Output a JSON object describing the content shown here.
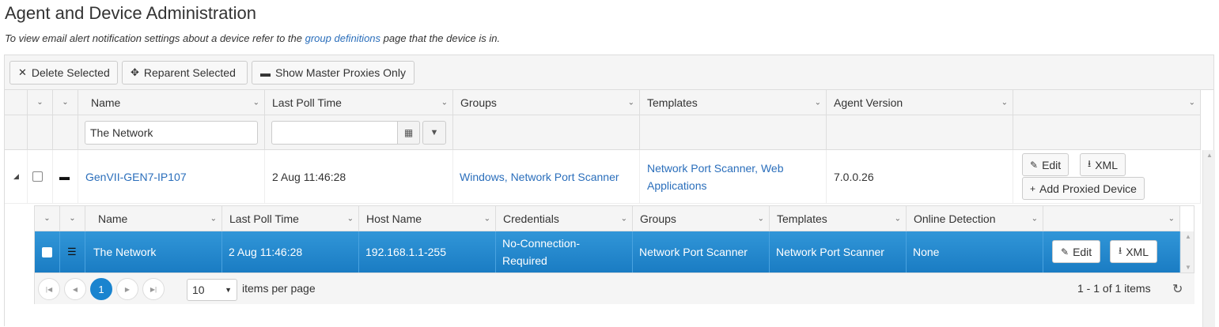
{
  "page": {
    "title": "Agent and Device Administration",
    "subtitle_prefix": "To view email alert notification settings about a device refer to the ",
    "subtitle_link": "group definitions",
    "subtitle_suffix": " page that the device is in."
  },
  "toolbar": {
    "delete_label": "Delete Selected",
    "reparent_label": "Reparent Selected",
    "master_proxies_label": "Show Master Proxies Only"
  },
  "columns": {
    "name": "Name",
    "last_poll_time": "Last Poll Time",
    "groups": "Groups",
    "templates": "Templates",
    "agent_version": "Agent Version"
  },
  "filters": {
    "name_value": "The Network",
    "last_poll_value": ""
  },
  "master_row": {
    "name": "GenVII-GEN7-IP107",
    "last_poll_time": "2 Aug 11:46:28",
    "groups": "Windows, Network Port Scanner",
    "templates": "Network Port Scanner, Web Applications",
    "agent_version": "7.0.0.26",
    "edit_label": "Edit",
    "xml_label": "XML",
    "add_proxied_label": "Add Proxied Device"
  },
  "detail_columns": {
    "name": "Name",
    "last_poll_time": "Last Poll Time",
    "host_name": "Host Name",
    "credentials": "Credentials",
    "groups": "Groups",
    "templates": "Templates",
    "online_detection": "Online Detection"
  },
  "detail_row": {
    "name": "The Network",
    "last_poll_time": "2 Aug 11:46:28",
    "host_name": "192.168.1.1-255",
    "credentials": "No-Connection-Required",
    "groups": "Network Port Scanner",
    "templates": "Network Port Scanner",
    "online_detection": "None",
    "edit_label": "Edit",
    "xml_label": "XML"
  },
  "pager": {
    "current_page": "1",
    "page_size": "10",
    "items_per_page_label": "items per page",
    "summary": "1 - 1 of 1 items"
  },
  "colors": {
    "link": "#2a6ebb",
    "selected_row": "#1a84cf"
  }
}
